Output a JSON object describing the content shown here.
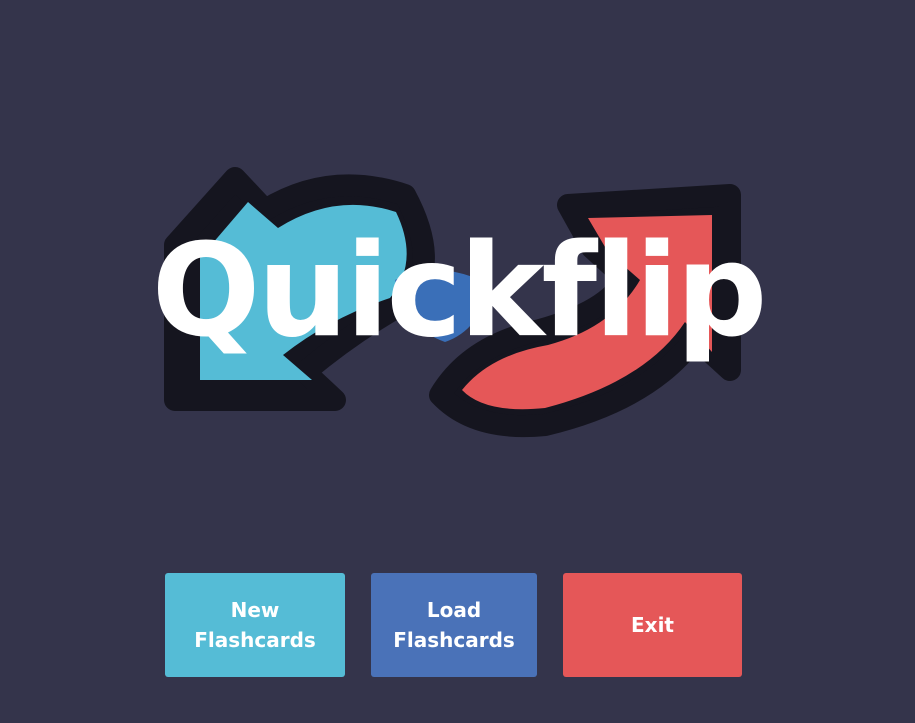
{
  "app": {
    "title": "Quickflip"
  },
  "logo": {
    "icon": "swap-arrows-icon",
    "colors": {
      "background": "#34344b",
      "outline": "#15151f",
      "left_arrow": "#55bcd6",
      "right_arrow": "#e55758",
      "overlap": "#3a6fb8"
    }
  },
  "menu": {
    "new_flashcards": {
      "line1": "New",
      "line2": "Flashcards",
      "color": "#55bcd6"
    },
    "load_flashcards": {
      "line1": "Load",
      "line2": "Flashcards",
      "color": "#4a72b8"
    },
    "exit": {
      "label": "Exit",
      "color": "#e55758"
    }
  }
}
